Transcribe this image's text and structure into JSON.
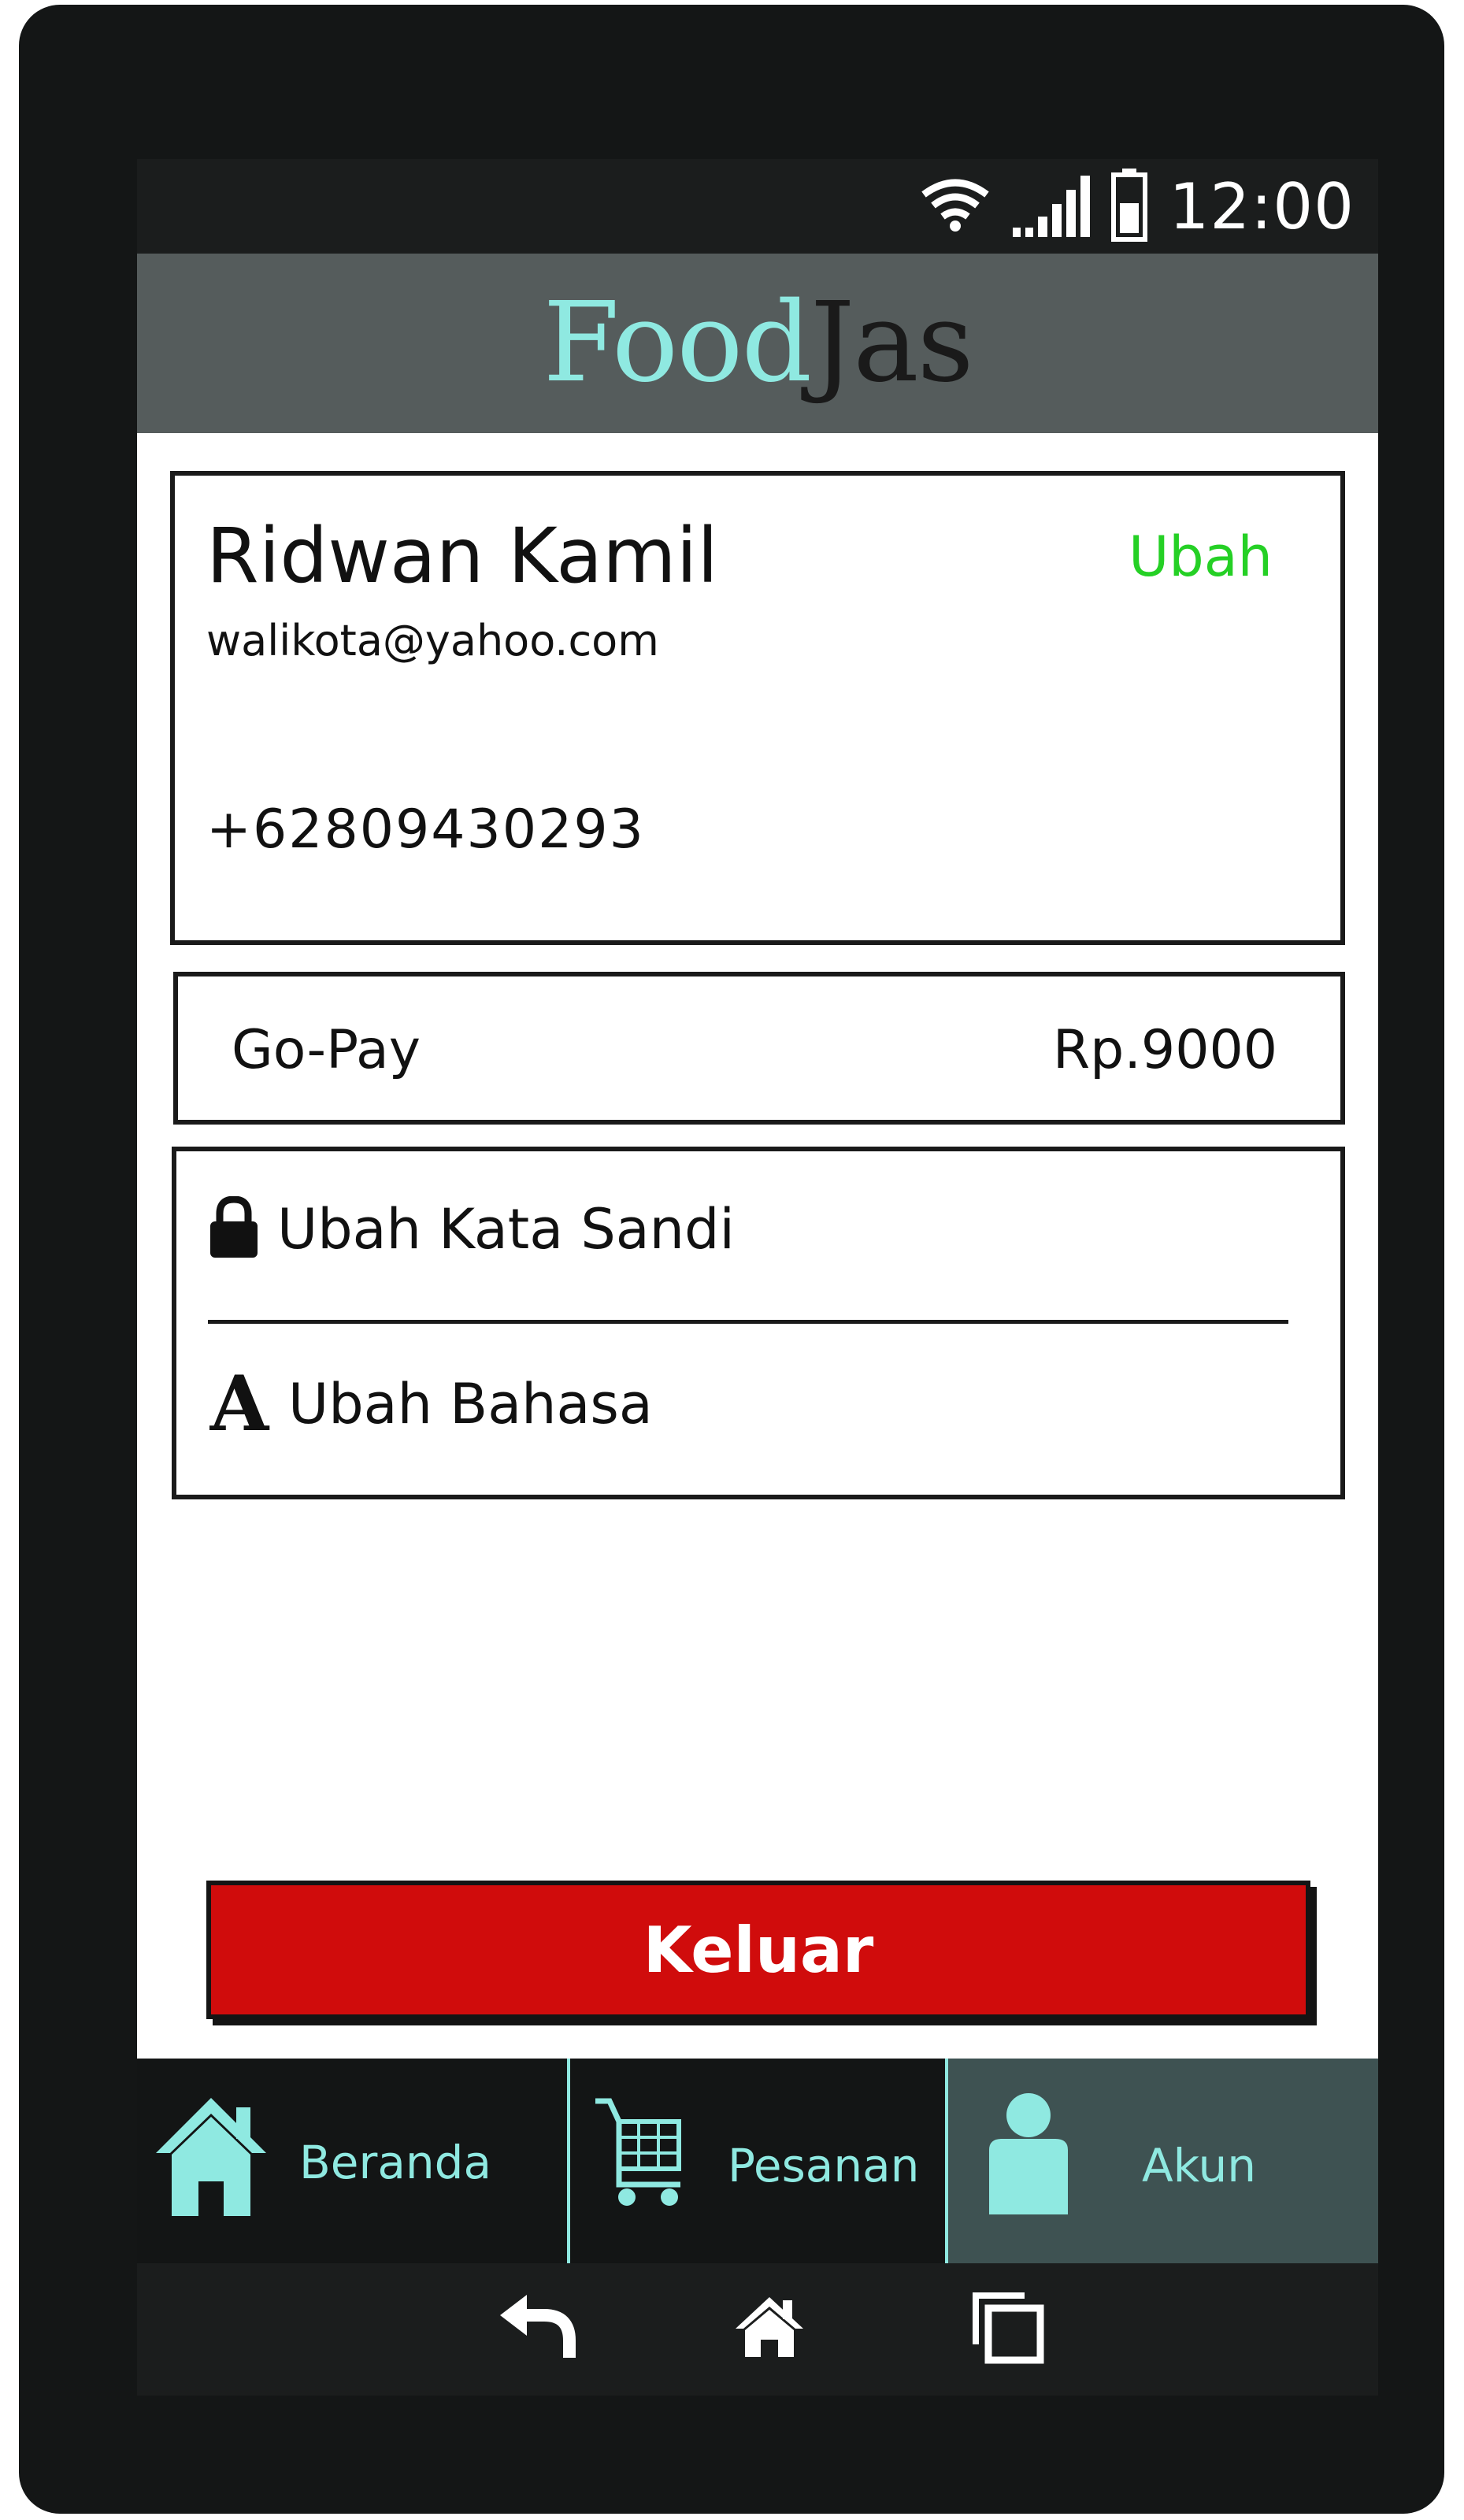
{
  "status_bar": {
    "time": "12:00",
    "icons": [
      "wifi-icon",
      "signal-icon",
      "battery-icon"
    ]
  },
  "app_header": {
    "brand_part1": "Food",
    "brand_part2": "Jas"
  },
  "profile": {
    "name": "Ridwan Kamil",
    "edit_label": "Ubah",
    "email": "walikota@yahoo.com",
    "phone": "+62809430293"
  },
  "wallet": {
    "name": "Go-Pay",
    "balance": "Rp.9000"
  },
  "settings": {
    "items": [
      {
        "label": "Ubah Kata Sandi",
        "icon": "lock-icon"
      },
      {
        "label": "Ubah Bahasa",
        "icon": "language-icon",
        "icon_glyph": "A"
      }
    ]
  },
  "logout_label": "Keluar",
  "bottom_nav": {
    "items": [
      {
        "label": "Beranda",
        "icon": "home-icon",
        "active": false
      },
      {
        "label": "Pesanan",
        "icon": "cart-icon",
        "active": false
      },
      {
        "label": "Akun",
        "icon": "user-icon",
        "active": true
      }
    ]
  },
  "system_nav": {
    "icons": [
      "back-icon",
      "home-icon",
      "recent-apps-icon"
    ]
  },
  "colors": {
    "brand_accent": "#8fe9e1",
    "header_bg": "#555c5c",
    "edit_link": "#25d025",
    "logout_bg": "#d00c0c",
    "nav_active_bg": "#3e5252",
    "nav_bg": "#131515"
  }
}
